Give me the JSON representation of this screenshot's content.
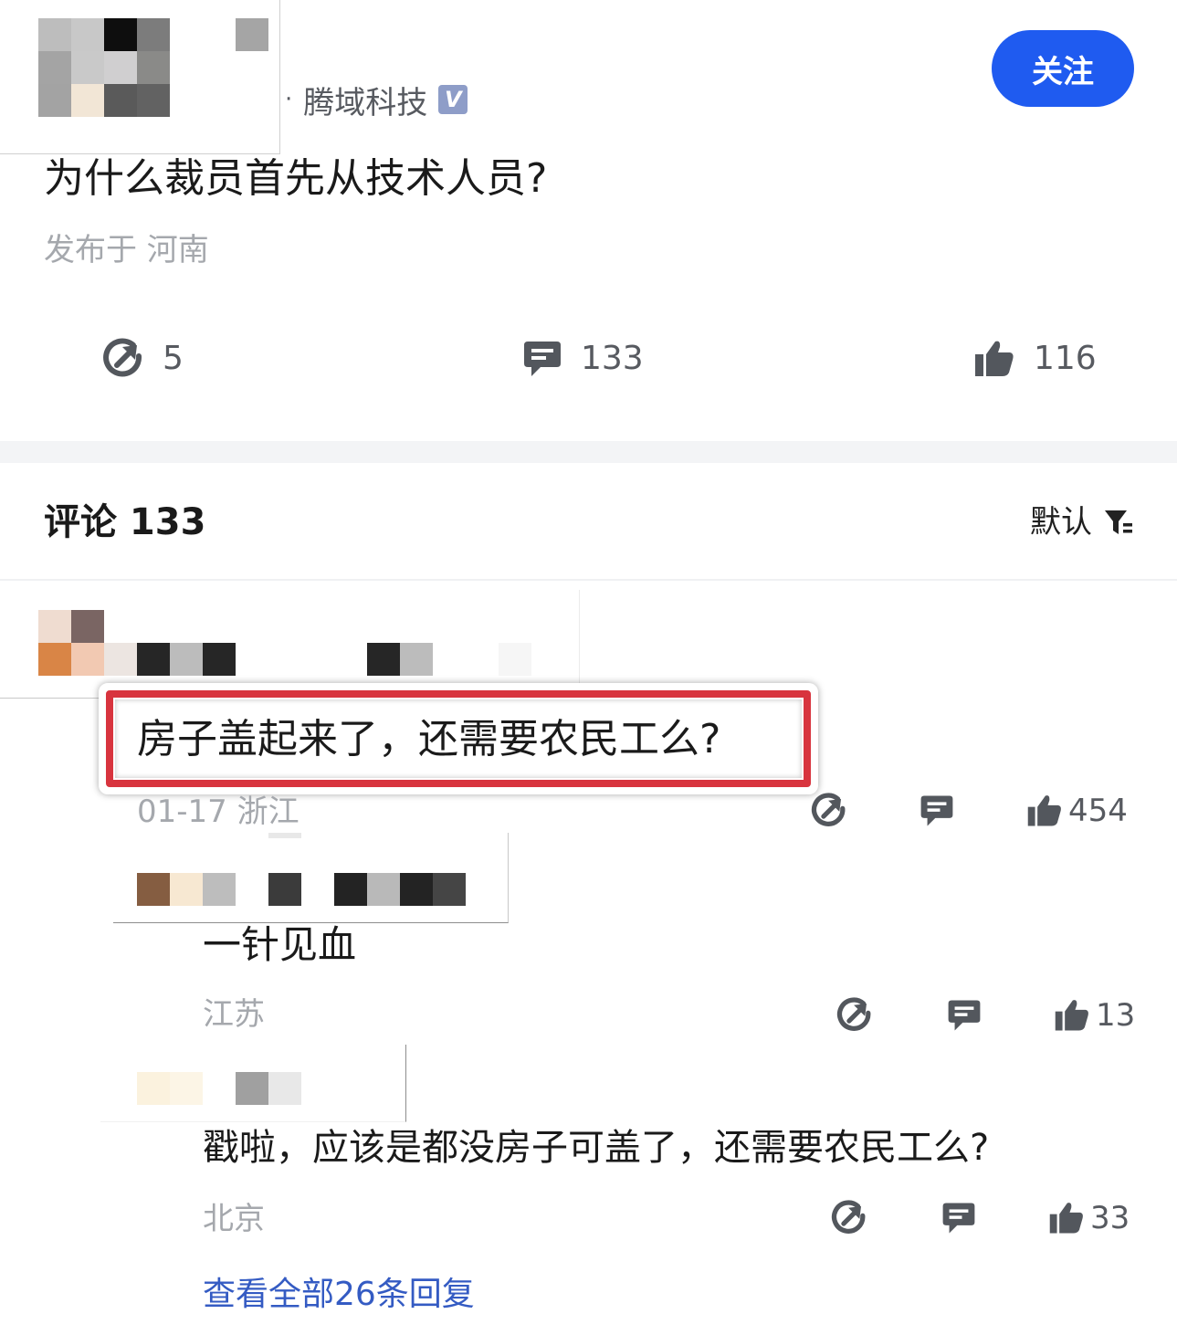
{
  "post": {
    "author_org": "腾域科技",
    "verified_badge": "V",
    "follow_label": "关注",
    "title": "为什么裁员首先从技术人员?",
    "location": "发布于 河南",
    "actions": {
      "forward_count": "5",
      "comment_count": "133",
      "like_count": "116"
    }
  },
  "comments_header": {
    "title": "评论 133",
    "sort_label": "默认"
  },
  "top_comment": {
    "text": "房子盖起来了，还需要农民工么?",
    "meta": "01-17 浙江",
    "like_count": "454"
  },
  "replies": [
    {
      "text": "一针见血",
      "location": "江苏",
      "like_count": "13"
    },
    {
      "text": "戳啦，应该是都没房子可盖了，还需要农民工么?",
      "location": "北京",
      "like_count": "33"
    }
  ],
  "view_all_replies": "查看全部26条回复",
  "colors": {
    "follow_button": "#1f5bf0",
    "link": "#345bc3",
    "highlight_border": "#d8343e",
    "divider": "#f3f4f6",
    "icon": "#53575d"
  }
}
